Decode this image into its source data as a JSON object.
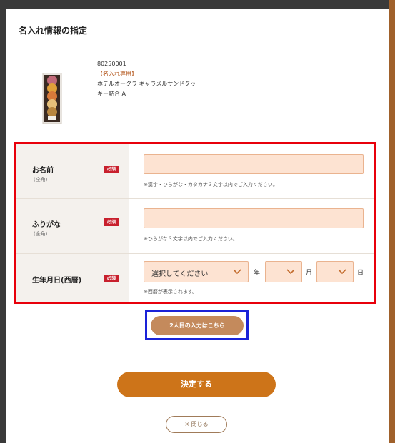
{
  "dialog": {
    "title": "名入れ情報の指定"
  },
  "product": {
    "code": "80250001",
    "tag": "【名入れ専用】",
    "name": "ホテルオークラ キャラメルサンドクッキー詰合 A",
    "image_icon": "cookie-box-icon"
  },
  "form": {
    "name": {
      "label": "お名前",
      "sub": "(全角)",
      "required": "必須",
      "value": "",
      "note": "※漢字・ひらがな・カタカナ３文字以内でご入力ください。"
    },
    "kana": {
      "label": "ふりがな",
      "sub": "(全角)",
      "required": "必須",
      "value": "",
      "note": "※ひらがな３文字以内でご入力ください。"
    },
    "birth": {
      "label": "生年月日(西暦)",
      "required": "必須",
      "year_value": "選択してください",
      "year_unit": "年",
      "month_value": "",
      "month_unit": "月",
      "day_value": "",
      "day_unit": "日",
      "note": "※西暦が表示されます。"
    }
  },
  "buttons": {
    "add_second": "2人目の入力はこちら",
    "submit": "決定する",
    "close": "× 閉じる"
  },
  "colors": {
    "required_badge": "#c8202d",
    "input_bg": "#fde3d2",
    "submit": "#cd7419",
    "add_second": "#c48a5c",
    "highlight_red": "#e8000b",
    "highlight_blue": "#1a22d8"
  }
}
